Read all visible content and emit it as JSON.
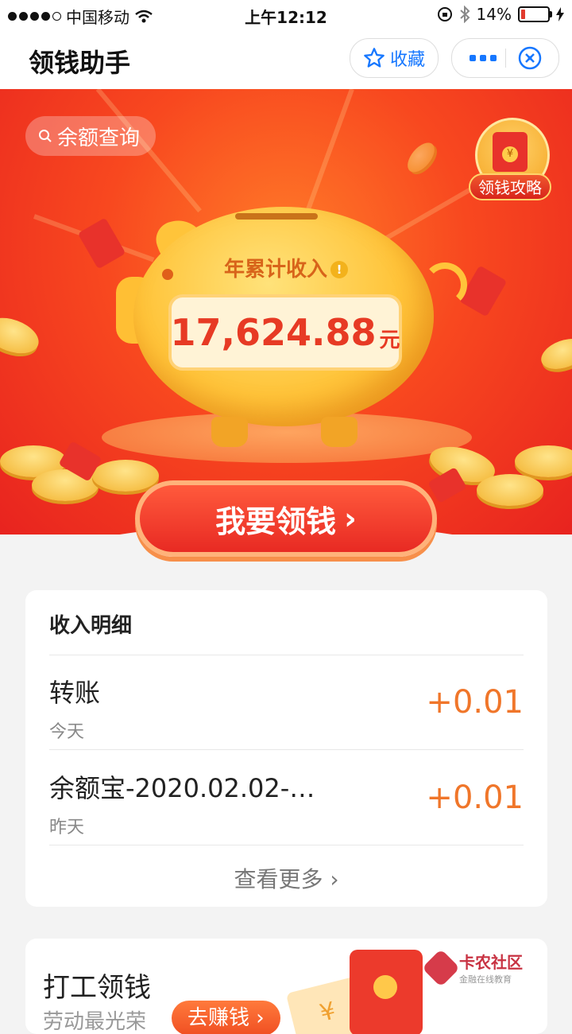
{
  "status_bar": {
    "carrier": "中国移动",
    "time": "上午12:12",
    "battery": "14%"
  },
  "nav": {
    "title": "领钱助手",
    "favorite_label": "收藏"
  },
  "hero": {
    "search_label": "余额查询",
    "guide_label": "领钱攻略",
    "guide_coin": "¥",
    "income_label": "年累计收入",
    "info_mark": "!",
    "amount": "17,624.88",
    "amount_unit": "元",
    "cta_label": "我要领钱",
    "cta_arrow": "›"
  },
  "income_detail": {
    "title": "收入明细",
    "rows": [
      {
        "name": "转账",
        "date": "今天",
        "amount": "+0.01"
      },
      {
        "name": "余额宝-2020.02.02-…",
        "date": "昨天",
        "amount": "+0.01"
      }
    ],
    "more_label": "查看更多",
    "more_arrow": "›"
  },
  "work_card": {
    "title": "打工领钱",
    "subtitle": "劳动最光荣",
    "button_label": "去赚钱 ›",
    "ticket_symbol": "¥"
  },
  "watermark": {
    "name": "卡农社区",
    "sub": "金融在线教育"
  },
  "colors": {
    "accent_blue": "#1677ff",
    "hero_red": "#e8231f",
    "amount_red": "#e73a24",
    "income_orange": "#f0762a"
  }
}
